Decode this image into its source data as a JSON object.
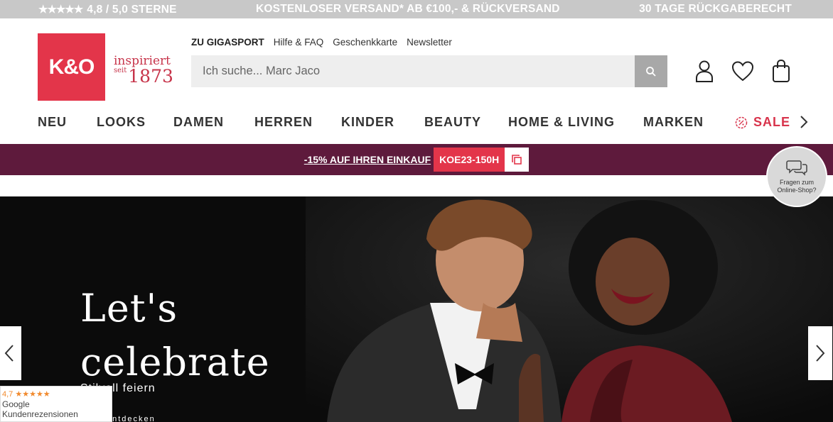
{
  "topbar": {
    "rating_stars": "★★★★★",
    "rating_text": "4,8 / 5,0 STERNE",
    "shipping": "KOSTENLOSER VERSAND* AB €100,- & RÜCKVERSAND",
    "returns": "30 TAGE RÜCKGABERECHT"
  },
  "logo": {
    "text": "K&O",
    "tagline_1": "inspiriert",
    "tagline_2": "seit",
    "tagline_3": "1873"
  },
  "sublinks": [
    "ZU GIGASPORT",
    "Hilfe & FAQ",
    "Geschenkkarte",
    "Newsletter"
  ],
  "search": {
    "placeholder": "Ich suche... Marc Jaco"
  },
  "header_icons": [
    "user-icon",
    "heart-icon",
    "bag-icon"
  ],
  "nav": [
    "NEU",
    "LOOKS",
    "DAMEN",
    "HERREN",
    "KINDER",
    "BEAUTY",
    "HOME & LIVING",
    "MARKEN",
    "SALE"
  ],
  "promo": {
    "text": "-15% AUF IHREN EINKAUF",
    "code": "KOE23-150H"
  },
  "hero": {
    "title_1": "Let's",
    "title_2": "celebrate",
    "subtitle": "Stilvoll feiern",
    "cta": "entdecken"
  },
  "chat": {
    "label_1": "Fragen zum",
    "label_2": "Online-Shop?"
  },
  "review": {
    "score": "4,7",
    "stars": "★★★★★",
    "provider": "Google",
    "label": "Kundenrezensionen"
  },
  "colors": {
    "brand": "#e3354a",
    "promo_bg": "#5e1a3c",
    "topbar_bg": "#c8c8c8"
  }
}
